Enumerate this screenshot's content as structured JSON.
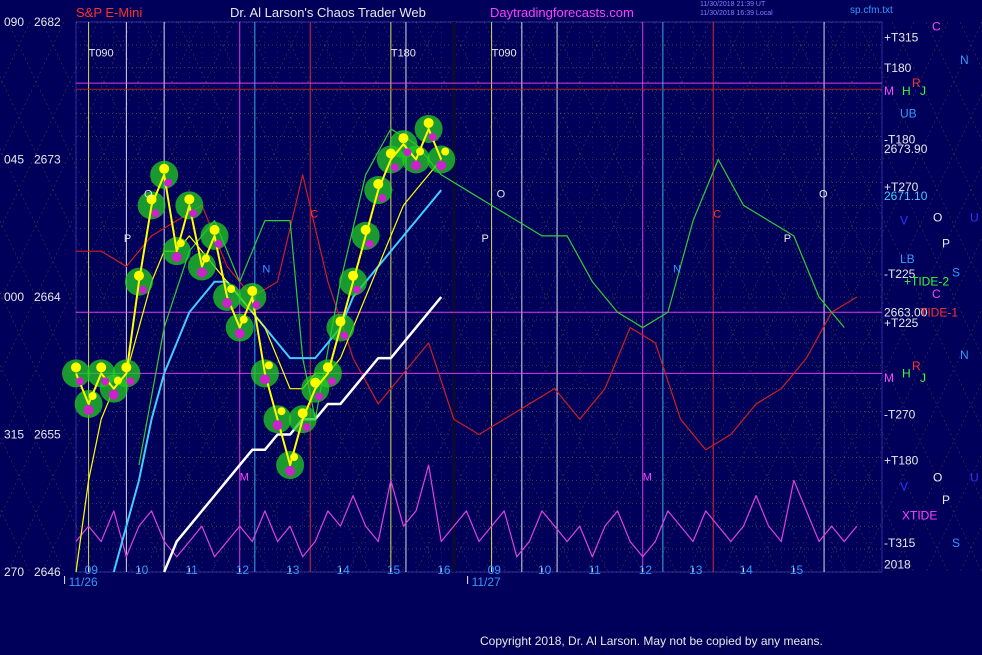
{
  "header": {
    "symbol": "S&P E-Mini",
    "site_title": "Dr. Al Larson's Chaos Trader Web",
    "url": "Daytradingforecasts.com",
    "small_stamp_1": "11/30/2018 21:39 UT",
    "small_stamp_2": "11/30/2018 16:39 Local",
    "corner_tag": "sp.cfm.txt",
    "top_left_value": "090",
    "colors": {
      "symbol": "#ff3030",
      "site_title": "#e8e8e8",
      "url": "#ff40ff",
      "stamp": "#8080ff",
      "tag": "#3399ff"
    }
  },
  "copyright": "Copyright 2018, Dr. Al Larson. May not be copied by any means.",
  "chart_data": {
    "type": "line",
    "title": "S&P E-Mini",
    "xlabel": "",
    "ylabel": "",
    "ylim": [
      2646,
      2682
    ],
    "y_ticks": [
      {
        "value": 2682,
        "label": "2682",
        "left_label": "090"
      },
      {
        "value": 2673,
        "label": "2673",
        "left_label": "045"
      },
      {
        "value": 2664,
        "label": "2664",
        "left_label": "000"
      },
      {
        "value": 2655,
        "label": "2655",
        "left_label": "315"
      },
      {
        "value": 2646,
        "label": "2646",
        "left_label": "270"
      }
    ],
    "x_range": [
      8.75,
      24.75
    ],
    "x_ticks": [
      {
        "x": 9,
        "label": "09"
      },
      {
        "x": 10,
        "label": "10"
      },
      {
        "x": 11,
        "label": "11"
      },
      {
        "x": 12,
        "label": "12"
      },
      {
        "x": 13,
        "label": "13"
      },
      {
        "x": 14,
        "label": "14"
      },
      {
        "x": 15,
        "label": "15"
      },
      {
        "x": 16,
        "label": "16"
      },
      {
        "x": 17,
        "label": "09"
      },
      {
        "x": 18,
        "label": "10"
      },
      {
        "x": 19,
        "label": "11"
      },
      {
        "x": 20,
        "label": "12"
      },
      {
        "x": 21,
        "label": "13"
      },
      {
        "x": 22,
        "label": "14"
      },
      {
        "x": 23,
        "label": "15"
      }
    ],
    "date_labels": [
      {
        "x": 9,
        "label": "11/26"
      },
      {
        "x": 17,
        "label": "11/27"
      }
    ],
    "grid": true,
    "colors": {
      "background": "#00005a",
      "grid": "#8a8a30",
      "price": "#ffff00",
      "flux_glow": "#22cc22",
      "magenta_dots": "#cc22cc"
    },
    "series": [
      {
        "color": "#ffff00",
        "x": [
          8.75,
          9.0,
          9.25,
          9.5,
          9.75,
          10.0,
          10.25,
          10.5,
          10.75,
          11.0,
          11.25,
          11.5,
          11.75,
          12.0,
          12.25,
          12.5,
          12.75,
          13.0,
          13.25,
          13.5,
          13.75,
          14.0,
          14.25,
          14.5,
          14.75,
          15.0,
          15.25,
          15.5,
          15.75,
          16.0
        ],
        "values": [
          2659,
          2657,
          2659,
          2658,
          2659,
          2665,
          2670,
          2672,
          2667,
          2670,
          2666,
          2668,
          2664,
          2662,
          2664,
          2659,
          2656,
          2653,
          2656,
          2658,
          2659,
          2662,
          2665,
          2668,
          2671,
          2673,
          2674,
          2673,
          2675,
          2673
        ]
      },
      {
        "color": "#ffff00",
        "x": [
          8.75,
          9.0,
          9.25,
          9.5,
          9.75,
          10.0,
          10.25,
          10.5,
          10.75,
          11.0,
          11.25,
          11.5,
          11.75,
          12.0,
          12.25,
          12.5,
          12.75,
          13.0,
          13.25,
          13.5,
          13.75,
          14.0,
          14.25,
          14.5,
          14.75,
          15.0,
          15.25,
          15.5,
          15.75,
          16.0
        ],
        "values": [
          2646,
          2652,
          2656,
          2658,
          2659,
          2662,
          2665,
          2667,
          2667,
          2668,
          2667,
          2666,
          2665,
          2664,
          2663,
          2662,
          2660,
          2658,
          2658,
          2659,
          2659,
          2660,
          2662,
          2664,
          2666,
          2668,
          2670,
          2671,
          2672,
          2673
        ]
      },
      {
        "color": "#44ccff",
        "x": [
          9.5,
          9.75,
          10.0,
          10.25,
          10.5,
          10.75,
          11.0,
          11.25,
          11.5,
          11.75,
          12.0,
          12.25,
          12.5,
          12.75,
          13.0,
          13.25,
          13.5,
          13.75,
          14.0,
          14.25,
          14.5,
          14.75,
          15.0,
          15.25,
          15.5,
          15.75,
          16.0
        ],
        "values": [
          2646,
          2649,
          2652,
          2656,
          2659,
          2661,
          2663,
          2664,
          2665,
          2665,
          2664,
          2663,
          2662,
          2661,
          2660,
          2660,
          2660,
          2661,
          2662,
          2664,
          2665,
          2666,
          2667,
          2668,
          2669,
          2670,
          2671
        ]
      },
      {
        "color": "#ffffff",
        "x": [
          10.5,
          10.75,
          11.0,
          11.25,
          11.5,
          11.75,
          12.0,
          12.25,
          12.5,
          12.75,
          13.0,
          13.25,
          13.5,
          13.75,
          14.0,
          14.25,
          14.5,
          14.75,
          15.0,
          15.25,
          15.5,
          15.75,
          16.0
        ],
        "values": [
          2646,
          2648,
          2649,
          2650,
          2651,
          2652,
          2653,
          2654,
          2654,
          2655,
          2655,
          2656,
          2656,
          2657,
          2657,
          2658,
          2659,
          2660,
          2660,
          2661,
          2662,
          2663,
          2664
        ]
      },
      {
        "color": "#33cc33",
        "x": [
          10.0,
          10.5,
          11.0,
          11.5,
          12.0,
          12.5,
          13.0,
          13.25,
          13.5,
          14.0,
          14.5,
          15.0,
          15.5,
          16.0,
          16.5,
          17.0,
          17.5,
          18.0,
          18.5,
          19.0,
          19.5,
          20.0,
          20.5,
          21.0,
          21.5,
          22.0,
          22.5,
          23.0,
          23.5,
          24.0
        ],
        "values": [
          2653,
          2662,
          2667,
          2669,
          2665,
          2669,
          2669,
          2660,
          2656,
          2665,
          2672,
          2675,
          2674,
          2672,
          2671,
          2670,
          2669,
          2668,
          2668,
          2665,
          2663,
          2662,
          2663,
          2669,
          2673,
          2670,
          2669,
          2668,
          2664,
          2662
        ]
      },
      {
        "color": "#cc2020",
        "x": [
          8.75,
          9.25,
          9.75,
          10.25,
          10.75,
          11.25,
          11.75,
          12.25,
          12.75,
          13.25,
          13.75,
          14.25,
          14.75,
          15.25,
          15.75,
          16.25,
          16.75,
          17.25,
          17.75,
          18.25,
          18.75,
          19.25,
          19.75,
          20.25,
          20.75,
          21.25,
          21.75,
          22.25,
          22.75,
          23.25,
          23.75,
          24.25
        ],
        "values": [
          2667,
          2667,
          2666,
          2668,
          2669,
          2670,
          2666,
          2664,
          2665,
          2672,
          2665,
          2660,
          2657,
          2659,
          2661,
          2656,
          2655,
          2656,
          2657,
          2658,
          2656,
          2658,
          2662,
          2661,
          2656,
          2654,
          2655,
          2657,
          2658,
          2660,
          2663,
          2664
        ]
      },
      {
        "color": "#dd44dd",
        "x": [
          8.75,
          9.0,
          9.25,
          9.5,
          9.75,
          10.0,
          10.25,
          10.5,
          10.75,
          11.0,
          11.25,
          11.5,
          11.75,
          12.0,
          12.25,
          12.5,
          12.75,
          13.0,
          13.25,
          13.5,
          13.75,
          14.0,
          14.25,
          14.5,
          14.75,
          15.0,
          15.25,
          15.5,
          15.75,
          16.0,
          16.25,
          16.5,
          16.75,
          17.0,
          17.25,
          17.5,
          17.75,
          18.0,
          18.25,
          18.5,
          18.75,
          19.0,
          19.25,
          19.5,
          19.75,
          20.0,
          20.25,
          20.5,
          20.75,
          21.0,
          21.25,
          21.5,
          21.75,
          22.0,
          22.25,
          22.5,
          22.75,
          23.0,
          23.25,
          23.5,
          23.75,
          24.0,
          24.25
        ],
        "values": [
          2648,
          2649,
          2648,
          2650,
          2647,
          2649,
          2650,
          2648,
          2647,
          2648,
          2649,
          2647,
          2648,
          2649,
          2648,
          2650,
          2648,
          2649,
          2647,
          2648,
          2650,
          2649,
          2651,
          2649,
          2648,
          2652,
          2649,
          2650,
          2653,
          2648,
          2649,
          2650,
          2648,
          2649,
          2650,
          2647,
          2648,
          2650,
          2649,
          2648,
          2649,
          2647,
          2649,
          2650,
          2648,
          2647,
          2648,
          2650,
          2649,
          2648,
          2650,
          2649,
          2648,
          2649,
          2651,
          2649,
          2648,
          2652,
          2650,
          2648,
          2649,
          2648,
          2649
        ]
      }
    ],
    "right_labels": [
      {
        "text": "+T315",
        "y": 2681,
        "color": "#e8e8e8"
      },
      {
        "text": "T180",
        "y": 2679,
        "color": "#e8e8e8"
      },
      {
        "text": "M",
        "y": 2677.5,
        "color": "#ff44ff"
      },
      {
        "text": "H",
        "y": 2677.5,
        "color": "#33ff33"
      },
      {
        "text": "R",
        "y": 2678,
        "color": "#ff3030"
      },
      {
        "text": "J",
        "y": 2677.5,
        "color": "#33ff33"
      },
      {
        "text": "UB",
        "y": 2676,
        "color": "#3399ff"
      },
      {
        "text": "-T180",
        "y": 2674.3,
        "color": "#e8e8e8"
      },
      {
        "text": "2673.90",
        "y": 2673.7,
        "color": "#e8e8e8"
      },
      {
        "text": "+T270",
        "y": 2671.2,
        "color": "#e8e8e8"
      },
      {
        "text": "2671.10",
        "y": 2670.6,
        "color": "#44ccff"
      },
      {
        "text": "V",
        "y": 2669,
        "color": "#3333ff"
      },
      {
        "text": "LB",
        "y": 2666.5,
        "color": "#3399ff"
      },
      {
        "text": "-T225",
        "y": 2665.5,
        "color": "#e8e8e8"
      },
      {
        "text": "+TIDE-2",
        "y": 2665,
        "color": "#33ff33"
      },
      {
        "text": "2663.00",
        "y": 2663,
        "color": "#e8e8e8"
      },
      {
        "text": "TIDE-1",
        "y": 2663,
        "color": "#ff3030"
      },
      {
        "text": "+T225",
        "y": 2662.3,
        "color": "#e8e8e8"
      },
      {
        "text": "M",
        "y": 2658.7,
        "color": "#ff44ff"
      },
      {
        "text": "H",
        "y": 2659,
        "color": "#33ff33"
      },
      {
        "text": "R",
        "y": 2659.5,
        "color": "#ff3030"
      },
      {
        "text": "J",
        "y": 2658.7,
        "color": "#33ff33"
      },
      {
        "text": "-T270",
        "y": 2656.3,
        "color": "#e8e8e8"
      },
      {
        "text": "+T180",
        "y": 2653.3,
        "color": "#e8e8e8"
      },
      {
        "text": "V",
        "y": 2651.6,
        "color": "#3333ff"
      },
      {
        "text": "XTIDE",
        "y": 2649.7,
        "color": "#ff44ff"
      },
      {
        "text": "-T315",
        "y": 2647.9,
        "color": "#e8e8e8"
      },
      {
        "text": "2018",
        "y": 2646.5,
        "color": "#e8e8e8"
      }
    ],
    "planet_labels": [
      {
        "text": "C",
        "y": 2681.7,
        "color": "#ff44ff"
      },
      {
        "text": "N",
        "y": 2679.5,
        "color": "#3399ff"
      },
      {
        "text": "O",
        "y": 2669.2,
        "color": "#e8e8e8"
      },
      {
        "text": "U",
        "y": 2669.2,
        "color": "#3333ff"
      },
      {
        "text": "P",
        "y": 2667.5,
        "color": "#e8e8e8"
      },
      {
        "text": "S",
        "y": 2665.6,
        "color": "#3399ff"
      },
      {
        "text": "C",
        "y": 2664.2,
        "color": "#ff44ff"
      },
      {
        "text": "N",
        "y": 2660.2,
        "color": "#3399ff"
      },
      {
        "text": "O",
        "y": 2652.2,
        "color": "#e8e8e8"
      },
      {
        "text": "U",
        "y": 2652.2,
        "color": "#3333ff"
      },
      {
        "text": "P",
        "y": 2650.7,
        "color": "#e8e8e8"
      },
      {
        "text": "S",
        "y": 2647.9,
        "color": "#3399ff"
      }
    ],
    "time_marks": [
      {
        "text": "T090",
        "x": 9.0,
        "y": 2680,
        "color": "#e8e8e8"
      },
      {
        "text": "T180",
        "x": 15.0,
        "y": 2680,
        "color": "#e8e8e8"
      },
      {
        "text": "T090",
        "x": 17.0,
        "y": 2680,
        "color": "#e8e8e8"
      }
    ],
    "in_chart_labels": [
      {
        "text": "O",
        "x": 10.1,
        "y": 2670.5,
        "color": "#e8e8e8"
      },
      {
        "text": "P",
        "x": 9.7,
        "y": 2667.6,
        "color": "#e8e8e8"
      },
      {
        "text": "N",
        "x": 12.45,
        "y": 2665.6,
        "color": "#3399ff"
      },
      {
        "text": "C",
        "x": 13.4,
        "y": 2669.2,
        "color": "#ff3030"
      },
      {
        "text": "M",
        "x": 12.0,
        "y": 2652.0,
        "color": "#ff44ff"
      },
      {
        "text": "O",
        "x": 17.1,
        "y": 2670.5,
        "color": "#e8e8e8"
      },
      {
        "text": "P",
        "x": 16.8,
        "y": 2667.6,
        "color": "#e8e8e8"
      },
      {
        "text": "N",
        "x": 20.6,
        "y": 2665.6,
        "color": "#3399ff"
      },
      {
        "text": "C",
        "x": 21.4,
        "y": 2669.2,
        "color": "#ff3030"
      },
      {
        "text": "M",
        "x": 20.0,
        "y": 2652.0,
        "color": "#ff44ff"
      },
      {
        "text": "O",
        "x": 23.5,
        "y": 2670.5,
        "color": "#e8e8e8"
      },
      {
        "text": "P",
        "x": 22.8,
        "y": 2667.6,
        "color": "#e8e8e8"
      }
    ],
    "horizontal_levels": [
      {
        "y": 2678,
        "color": "#ff44ff"
      },
      {
        "y": 2677.6,
        "color": "#cc2020"
      },
      {
        "y": 2663,
        "color": "#ff44ff"
      },
      {
        "y": 2659,
        "color": "#ff44ff"
      }
    ],
    "vertical_lines": [
      {
        "x": 9.0,
        "color": "#ffff55"
      },
      {
        "x": 9.75,
        "color": "#ffffff"
      },
      {
        "x": 10.5,
        "color": "#ffffff"
      },
      {
        "x": 12.0,
        "color": "#ff44ff"
      },
      {
        "x": 12.3,
        "color": "#44ccff"
      },
      {
        "x": 13.4,
        "color": "#ff3030"
      },
      {
        "x": 15.0,
        "color": "#ffff55"
      },
      {
        "x": 15.3,
        "color": "#ffffff"
      },
      {
        "x": 17.0,
        "color": "#ffff55"
      },
      {
        "x": 17.6,
        "color": "#ffffff"
      },
      {
        "x": 18.3,
        "color": "#ffffff"
      },
      {
        "x": 20.0,
        "color": "#ff44ff"
      },
      {
        "x": 20.4,
        "color": "#44ccff"
      },
      {
        "x": 21.4,
        "color": "#ff3030"
      },
      {
        "x": 23.6,
        "color": "#ffffff"
      }
    ]
  }
}
